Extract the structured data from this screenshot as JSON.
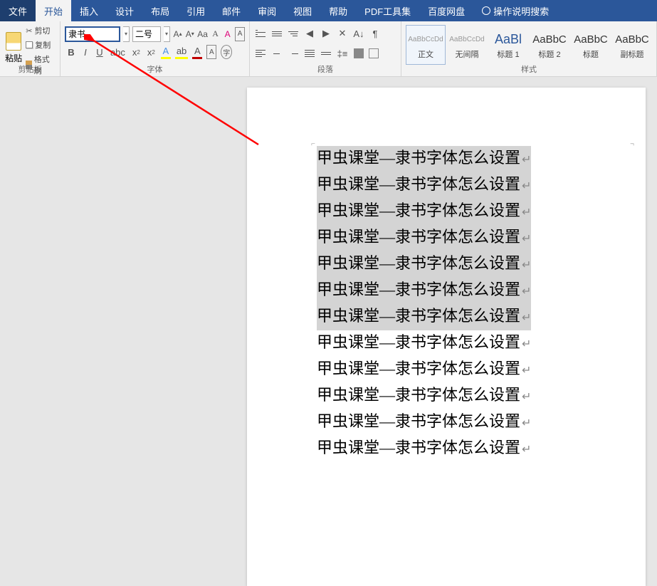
{
  "tabs": {
    "file": "文件",
    "home": "开始",
    "insert": "插入",
    "design": "设计",
    "layout": "布局",
    "references": "引用",
    "mailings": "邮件",
    "review": "审阅",
    "view": "视图",
    "help": "帮助",
    "pdf": "PDF工具集",
    "baidu": "百度网盘",
    "tellme": "操作说明搜索"
  },
  "clipboard": {
    "paste": "粘贴",
    "cut": "剪切",
    "copy": "复制",
    "format_painter": "格式刷",
    "label": "剪贴板"
  },
  "font": {
    "name": "隶书",
    "size": "二号",
    "bold": "B",
    "italic": "I",
    "underline": "U",
    "label": "字体"
  },
  "paragraph": {
    "label": "段落"
  },
  "styles": {
    "label": "样式",
    "items": [
      {
        "preview": "AaBbCcDd",
        "name": "正文",
        "cls": ""
      },
      {
        "preview": "AaBbCcDd",
        "name": "无间隔",
        "cls": ""
      },
      {
        "preview": "AaBl",
        "name": "标题 1",
        "cls": "big"
      },
      {
        "preview": "AaBbC",
        "name": "标题 2",
        "cls": "med"
      },
      {
        "preview": "AaBbC",
        "name": "标题",
        "cls": "med"
      },
      {
        "preview": "AaBbC",
        "name": "副标题",
        "cls": "med"
      }
    ]
  },
  "document": {
    "lines": [
      {
        "text": "甲虫课堂—隶书字体怎么设置",
        "selected": true
      },
      {
        "text": "甲虫课堂—隶书字体怎么设置",
        "selected": true
      },
      {
        "text": "甲虫课堂—隶书字体怎么设置",
        "selected": true
      },
      {
        "text": "甲虫课堂—隶书字体怎么设置",
        "selected": true
      },
      {
        "text": "甲虫课堂—隶书字体怎么设置",
        "selected": true
      },
      {
        "text": "甲虫课堂—隶书字体怎么设置",
        "selected": true
      },
      {
        "text": "甲虫课堂—隶书字体怎么设置",
        "selected": true
      },
      {
        "text": "甲虫课堂—隶书字体怎么设置",
        "selected": false
      },
      {
        "text": "甲虫课堂—隶书字体怎么设置",
        "selected": false
      },
      {
        "text": "甲虫课堂—隶书字体怎么设置",
        "selected": false
      },
      {
        "text": "甲虫课堂—隶书字体怎么设置",
        "selected": false
      },
      {
        "text": "甲虫课堂—隶书字体怎么设置",
        "selected": false
      }
    ]
  },
  "annotation": {
    "arrow_color": "#ff0000"
  }
}
